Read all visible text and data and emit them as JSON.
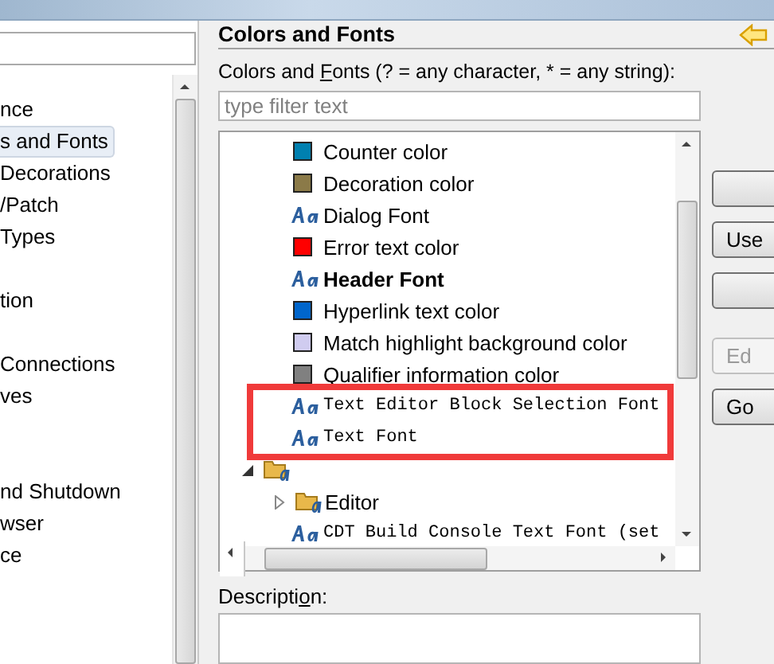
{
  "sidebar": {
    "items": [
      {
        "label": "nce",
        "selected": false
      },
      {
        "label": "s and Fonts",
        "selected": true
      },
      {
        "label": "Decorations",
        "selected": false
      },
      {
        "label": "/Patch",
        "selected": false
      },
      {
        "label": "Types",
        "selected": false
      },
      {
        "kind": "spacer"
      },
      {
        "label": "tion",
        "selected": false
      },
      {
        "kind": "spacer"
      },
      {
        "label": "Connections",
        "selected": false
      },
      {
        "label": "ves",
        "selected": false
      },
      {
        "kind": "spacer"
      },
      {
        "kind": "spacer"
      },
      {
        "label": "nd Shutdown",
        "selected": false
      },
      {
        "label": "wser",
        "selected": false
      },
      {
        "label": "ce",
        "selected": false
      }
    ]
  },
  "page": {
    "title": "Colors and Fonts",
    "filter_label": "Colors and **F**onts (? = any character, * = any string):",
    "filter": {
      "placeholder": "type filter text"
    },
    "tree": [
      {
        "kind": "color",
        "label": "Counter color",
        "color": "#0080b0",
        "highlighted": false
      },
      {
        "kind": "color",
        "label": "Decoration color",
        "color": "#8b7a48",
        "highlighted": false
      },
      {
        "kind": "font",
        "label": "Dialog Font",
        "bold": false,
        "mono": false,
        "highlighted": false
      },
      {
        "kind": "color",
        "label": "Error text color",
        "color": "#ff0000",
        "highlighted": false
      },
      {
        "kind": "font",
        "label": "Header Font",
        "bold": true,
        "mono": false,
        "highlighted": false
      },
      {
        "kind": "color",
        "label": "Hyperlink text color",
        "color": "#0066cc",
        "highlighted": false
      },
      {
        "kind": "color",
        "label": "Match highlight background color",
        "color": "#d0ccf0",
        "highlighted": false
      },
      {
        "kind": "color",
        "label": "Qualifier information color",
        "color": "#808080",
        "highlighted": false
      },
      {
        "kind": "font",
        "label": "Text Editor Block Selection Font",
        "bold": false,
        "mono": true,
        "highlighted": true
      },
      {
        "kind": "font",
        "label": "Text Font",
        "bold": false,
        "mono": true,
        "highlighted": true
      },
      {
        "kind": "category",
        "expanded": true,
        "highlighted": false,
        "children": [
          {
            "kind": "category",
            "label": "Editor",
            "expanded": false,
            "highlighted": false
          },
          {
            "kind": "font",
            "label": "CDT Build Console Text Font (set",
            "bold": false,
            "mono": true,
            "highlighted": false
          }
        ]
      }
    ],
    "buttons": [
      {
        "disabled": false
      },
      {
        "label": "Use",
        "disabled": false
      },
      {
        "disabled": false
      },
      {
        "label": "Ed",
        "disabled": true
      },
      {
        "label": "Go",
        "disabled": false
      }
    ],
    "description_label": "Descripti**o**n:"
  }
}
